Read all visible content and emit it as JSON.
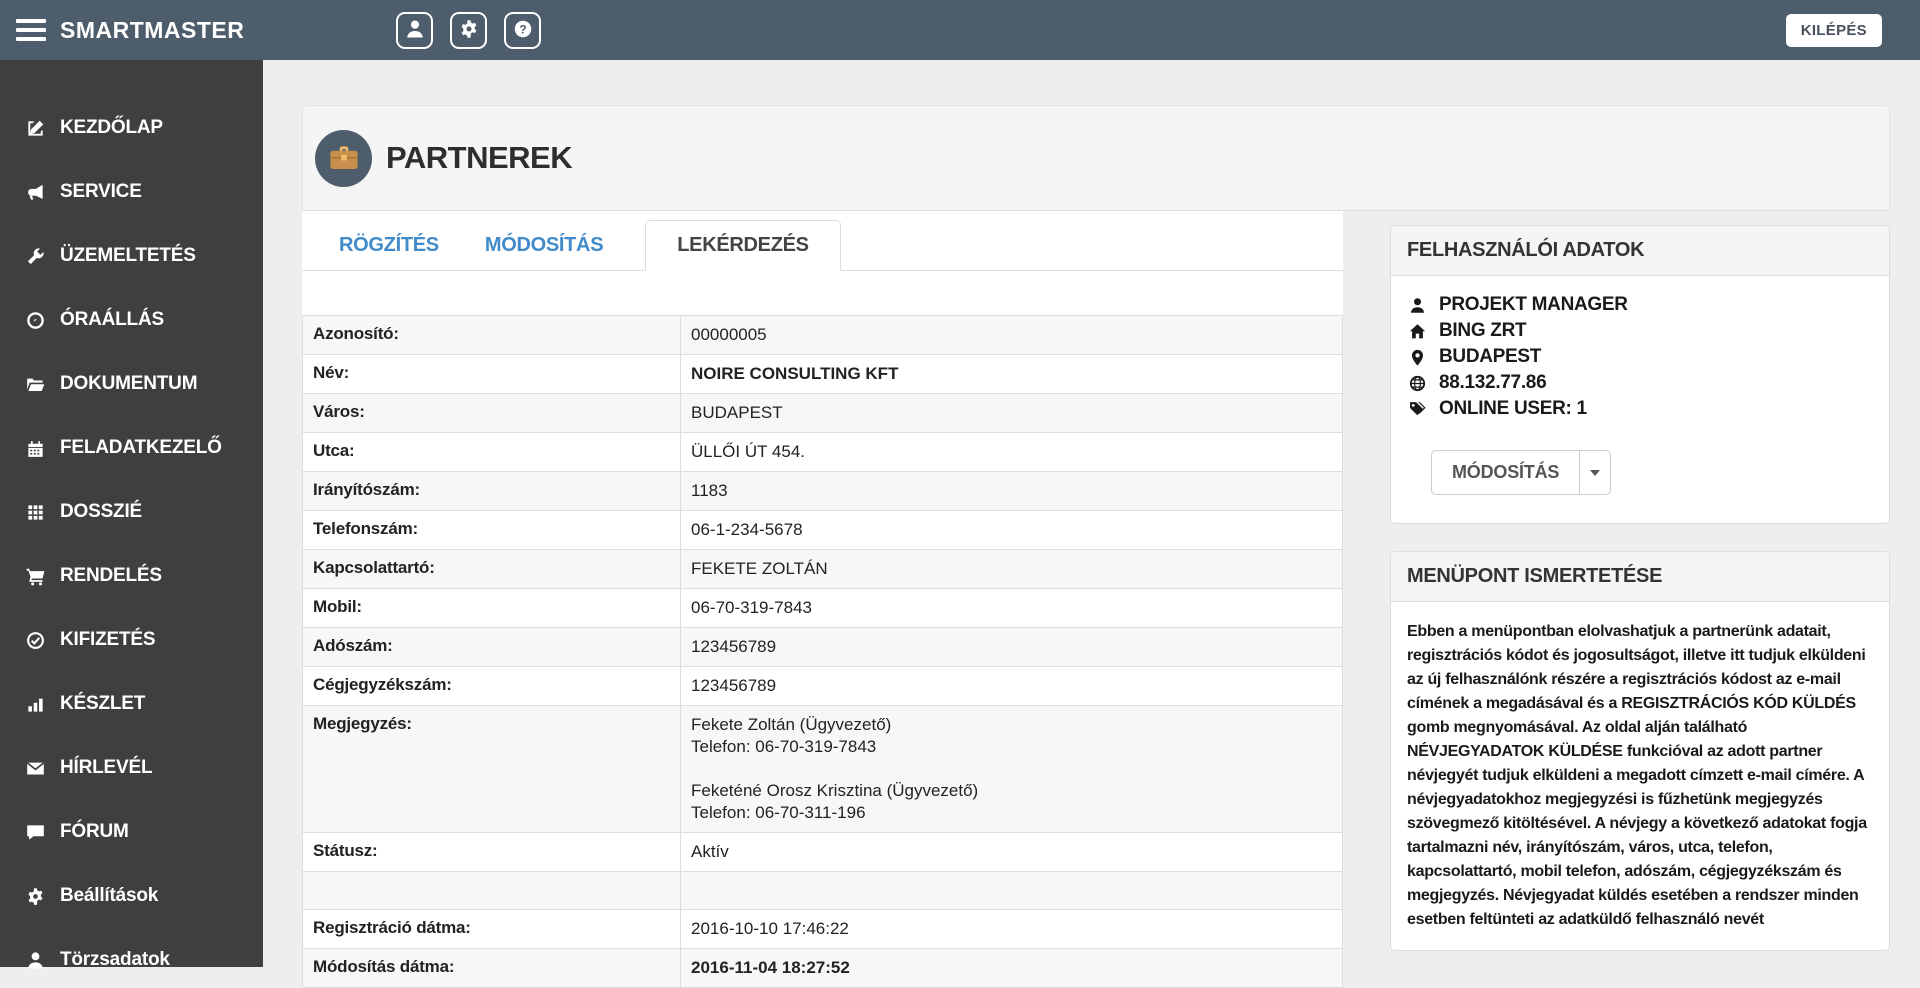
{
  "colors": {
    "topbar": "#4e5d6c",
    "sidebar": "#3f3f3f",
    "link_blue": "#428bca",
    "danger_red": "#d9534f",
    "briefcase_orange": "#c98f4c"
  },
  "topbar": {
    "brand": "SMARTMASTER",
    "logout_label": "KILÉPÉS"
  },
  "sidebar": {
    "items": [
      {
        "label": "KEZDŐLAP",
        "icon": "edit-icon"
      },
      {
        "label": "SERVICE",
        "icon": "bullhorn-icon"
      },
      {
        "label": "ÜZEMELTETÉS",
        "icon": "wrench-icon"
      },
      {
        "label": "ÓRAÁLLÁS",
        "icon": "gauge-icon"
      },
      {
        "label": "DOKUMENTUM",
        "icon": "folder-open-icon"
      },
      {
        "label": "FELADATKEZELŐ",
        "icon": "calendar-icon"
      },
      {
        "label": "DOSSZIÉ",
        "icon": "grid-icon"
      },
      {
        "label": "RENDELÉS",
        "icon": "cart-icon"
      },
      {
        "label": "KIFIZETÉS",
        "icon": "check-circle-icon"
      },
      {
        "label": "KÉSZLET",
        "icon": "bar-chart-icon"
      },
      {
        "label": "HÍRLEVÉL",
        "icon": "envelope-icon"
      },
      {
        "label": "FÓRUM",
        "icon": "comment-icon"
      },
      {
        "label": "Beállítások",
        "icon": "gear-icon"
      },
      {
        "label": "Törzsadatok",
        "icon": "user-icon"
      }
    ]
  },
  "page": {
    "title": "PARTNEREK"
  },
  "tabs": [
    {
      "label": "RÖGZÍTÉS",
      "active": false
    },
    {
      "label": "MÓDOSÍTÁS",
      "active": false
    },
    {
      "label": "LEKÉRDEZÉS",
      "active": true
    }
  ],
  "details": {
    "rows": [
      {
        "label": "Azonosító:",
        "value": "00000005"
      },
      {
        "label": "Név:",
        "value": "NOIRE CONSULTING KFT"
      },
      {
        "label": "Város:",
        "value": "BUDAPEST"
      },
      {
        "label": "Utca:",
        "value": "ÜLLŐI ÚT 454."
      },
      {
        "label": "Irányítószám:",
        "value": "1183"
      },
      {
        "label": "Telefonszám:",
        "value": "06-1-234-5678"
      },
      {
        "label": "Kapcsolattartó:",
        "value": "FEKETE ZOLTÁN"
      },
      {
        "label": "Mobil:",
        "value": "06-70-319-7843"
      },
      {
        "label": "Adószám:",
        "value": "123456789"
      },
      {
        "label": "Cégjegyzékszám:",
        "value": "123456789"
      },
      {
        "label": "Megjegyzés:",
        "value": "Fekete Zoltán (Ügyvezető)\nTelefon: 06-70-319-7843\n\nFeketéné Orosz Krisztina (Ügyvezető)\nTelefon: 06-70-311-196"
      },
      {
        "label": "Státusz:",
        "value": "Aktív"
      },
      {
        "label": "",
        "value": ""
      },
      {
        "label": "Regisztráció dátma:",
        "value": "2016-10-10 17:46:22"
      },
      {
        "label": "Módosítás dátma:",
        "value": "2016-11-04 18:27:52"
      }
    ]
  },
  "user_panel": {
    "title": "FELHASZNÁLÓI ADATOK",
    "items": [
      {
        "icon": "user-icon",
        "text": "PROJEKT MANAGER"
      },
      {
        "icon": "home-icon",
        "text": "BING ZRT"
      },
      {
        "icon": "marker-icon",
        "text": "BUDAPEST"
      },
      {
        "icon": "globe-icon",
        "text": "88.132.77.86"
      },
      {
        "icon": "tags-icon",
        "text": "ONLINE USER: 1"
      }
    ],
    "button_label": "MÓDOSÍTÁS"
  },
  "info_panel": {
    "title": "MENÜPONT ISMERTETÉSE",
    "text": "Ebben a menüpontban elolvashatjuk a partnerünk adatait, regisztrációs kódot és jogosultságot, illetve itt tudjuk elküldeni az új felhasználónk részére a regisztrációs kódost az e-mail címének a megadásával és a REGISZTRÁCIÓS KÓD KÜLDÉS gomb megnyomásával. Az oldal alján található NÉVJEGYADATOK KÜLDÉSE funkcióval az adott partner névjegyét tudjuk elküldeni a megadott címzett e-mail címére. A névjegyadatokhoz megjegyzési is fűzhetünk megjegyzés szövegmező kitöltésével. A névjegy a következő adatokat fogja tartalmazni név, irányítószám, város, utca, telefon, kapcsolattartó, mobil telefon, adószám, cégjegyzékszám és megjegyzés. Névjegyadat küldés esetében a rendszer minden esetben feltünteti az adatküldő felhasználó nevét"
  }
}
